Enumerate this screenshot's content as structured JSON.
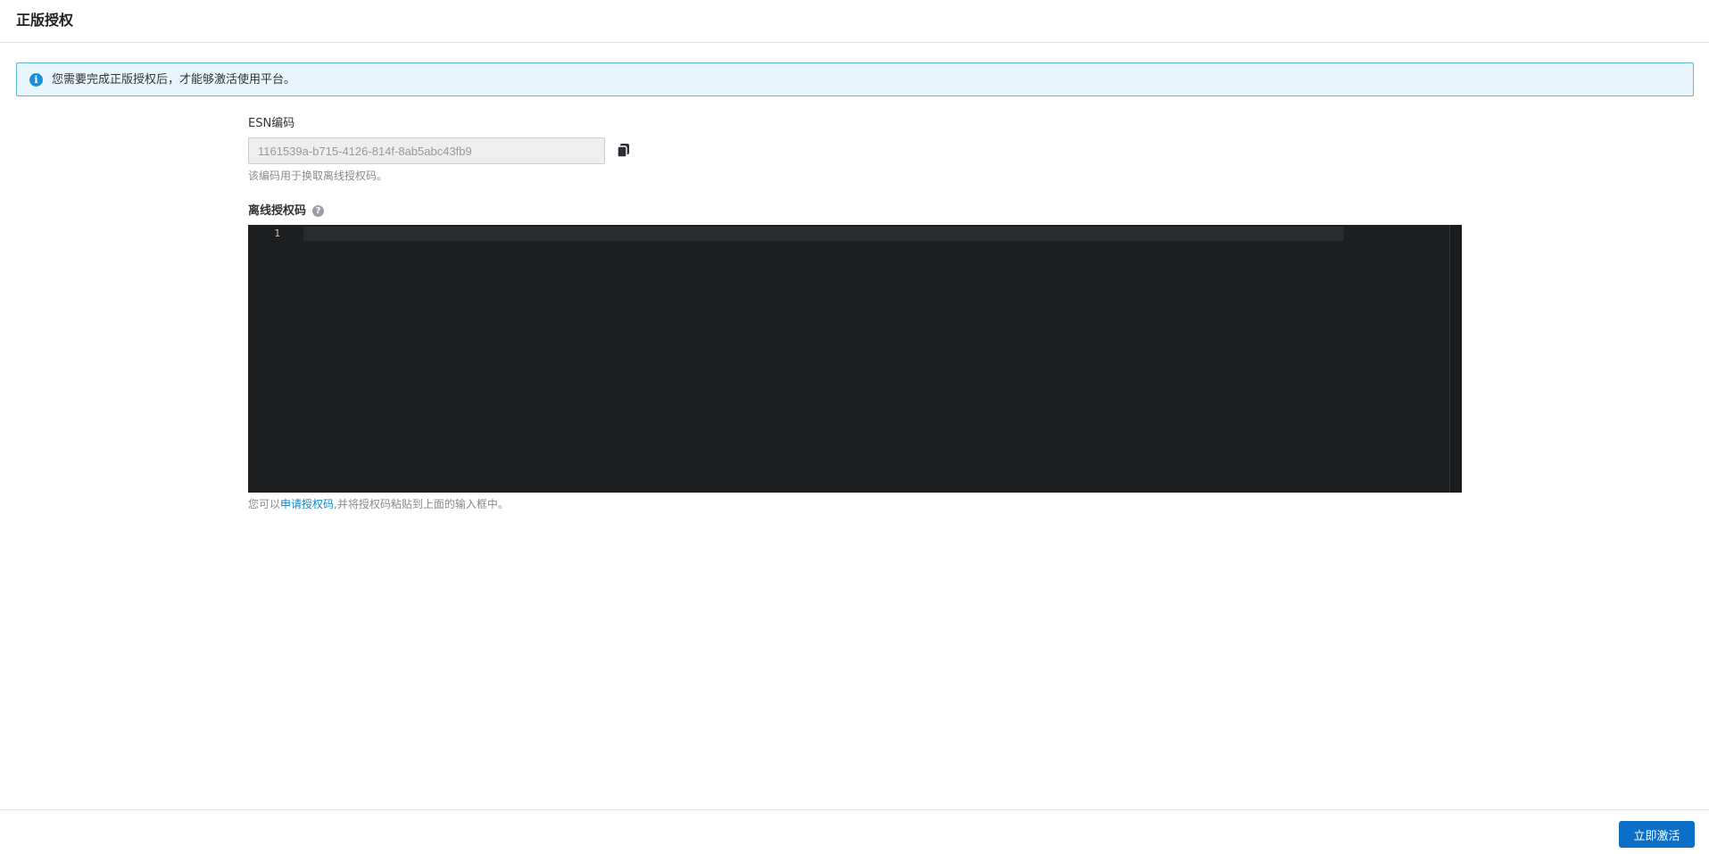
{
  "header": {
    "title": "正版授权"
  },
  "alert": {
    "icon": "info-icon",
    "text": "您需要完成正版授权后，才能够激活使用平台。"
  },
  "esn": {
    "label": "ESN编码",
    "value": "1161539a-b715-4126-814f-8ab5abc43fb9",
    "hint": "该编码用于换取离线授权码。",
    "copy_icon": "copy-icon"
  },
  "offline_code": {
    "label": "离线授权码",
    "help_icon": "question-icon",
    "editor": {
      "line_numbers": [
        "1"
      ],
      "content": ""
    },
    "hint_prefix": "您可以",
    "hint_link": "申请授权码",
    "hint_suffix": ",并将授权码粘贴到上面的输入框中。"
  },
  "footer": {
    "activate_label": "立即激活"
  },
  "colors": {
    "primary": "#0b6fc8",
    "link": "#0a8ad6",
    "alert_bg": "#e8f5fc",
    "editor_bg": "#1e1f21"
  }
}
